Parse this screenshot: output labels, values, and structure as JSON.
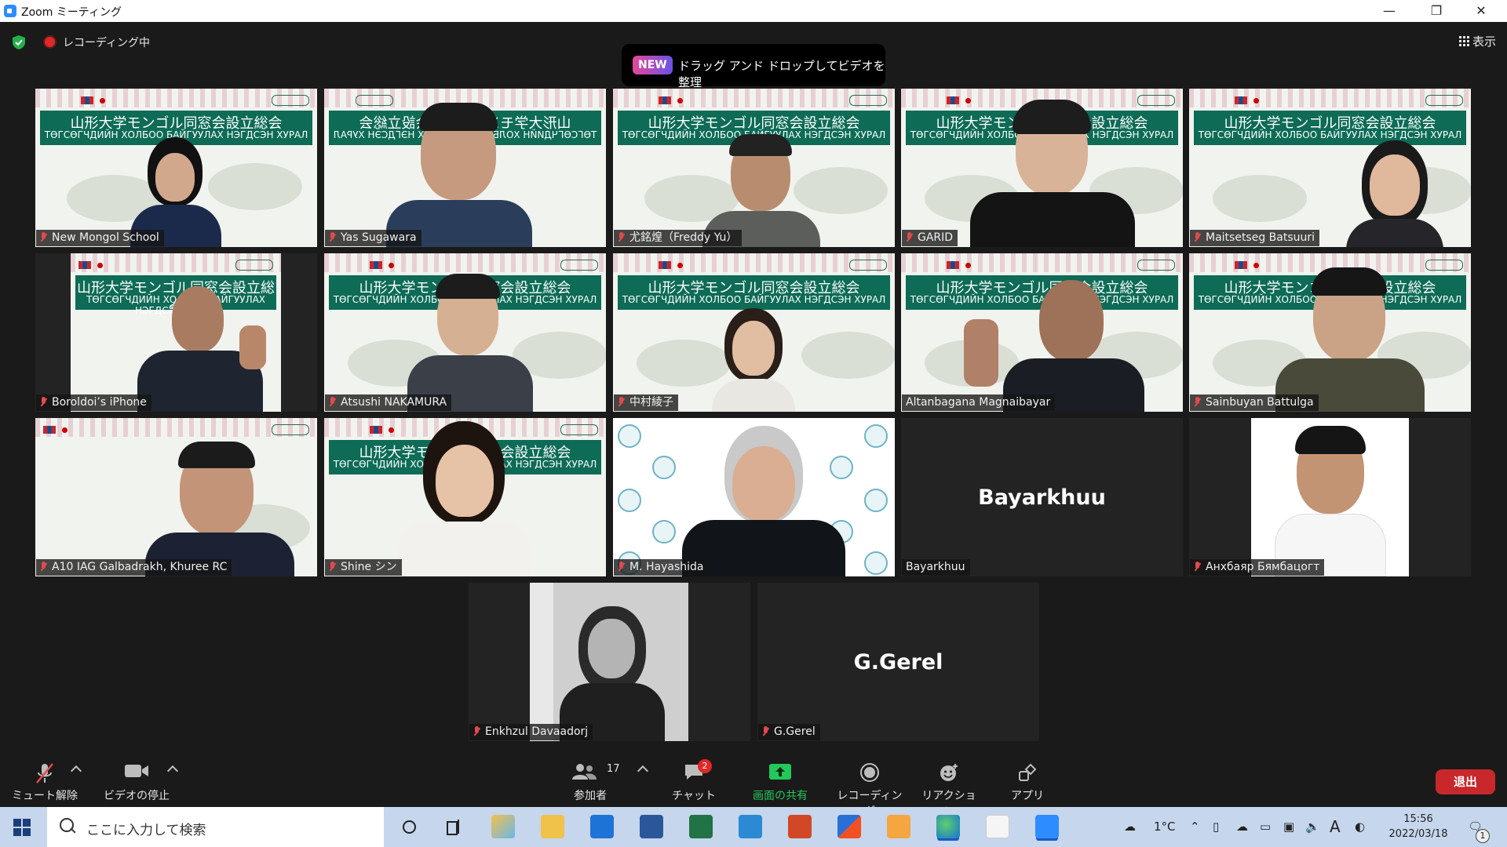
{
  "window": {
    "title": "Zoom ミーティング",
    "minimize": "—",
    "restore": "❐",
    "close": "✕"
  },
  "top": {
    "recording": "レコーディング中",
    "view": "表示",
    "banner_badge": "NEW",
    "banner_text": "ドラッグ アンド ドロップしてビデオを整理"
  },
  "slide": {
    "jp": "山形大学モンゴル同窓会設立総会",
    "mn": "ТӨГСӨГЧДИЙН ХОЛБОО БАЙГУУЛАХ НЭГДСЭН ХУРАЛ"
  },
  "participants": [
    {
      "name": "New Mongol School"
    },
    {
      "name": "Yas Sugawara"
    },
    {
      "name": "尤銘煌（Freddy Yu）"
    },
    {
      "name": "GARID"
    },
    {
      "name": "Maitsetseg Batsuuri"
    },
    {
      "name": "Boroldoi’s iPhone"
    },
    {
      "name": "Atsushi NAKAMURA"
    },
    {
      "name": "中村綾子"
    },
    {
      "name": "Altanbagana Magnaibayar"
    },
    {
      "name": "Sainbuyan Battulga"
    },
    {
      "name": "A10 IAG Galbadrakh, Khuree RC"
    },
    {
      "name": "Shine シン"
    },
    {
      "name": "M. Hayashida"
    },
    {
      "name": "Bayarkhuu",
      "display": "Bayarkhuu"
    },
    {
      "name": "Анхбаяр Бямбацогт"
    },
    {
      "name": "Enkhzul Davaadorj"
    },
    {
      "name": "G.Gerel",
      "display": "G.Gerel"
    }
  ],
  "toolbar": {
    "mute": "ミュート解除",
    "video": "ビデオの停止",
    "participants": "参加者",
    "participants_count": "17",
    "chat": "チャット",
    "chat_badge": "2",
    "share": "画面の共有",
    "record": "レコーディング",
    "reactions": "リアクション",
    "apps": "アプリ",
    "leave": "退出"
  },
  "taskbar": {
    "search_placeholder": "ここに入力して検索",
    "weather": "1°C",
    "ime": "A",
    "time": "15:56",
    "date": "2022/03/18",
    "notif_count": "1"
  },
  "colors": {
    "accent_green": "#0d6b56",
    "speaking_border": "#c9e63e",
    "leave_red": "#c8282b",
    "share_green": "#23c85a"
  }
}
